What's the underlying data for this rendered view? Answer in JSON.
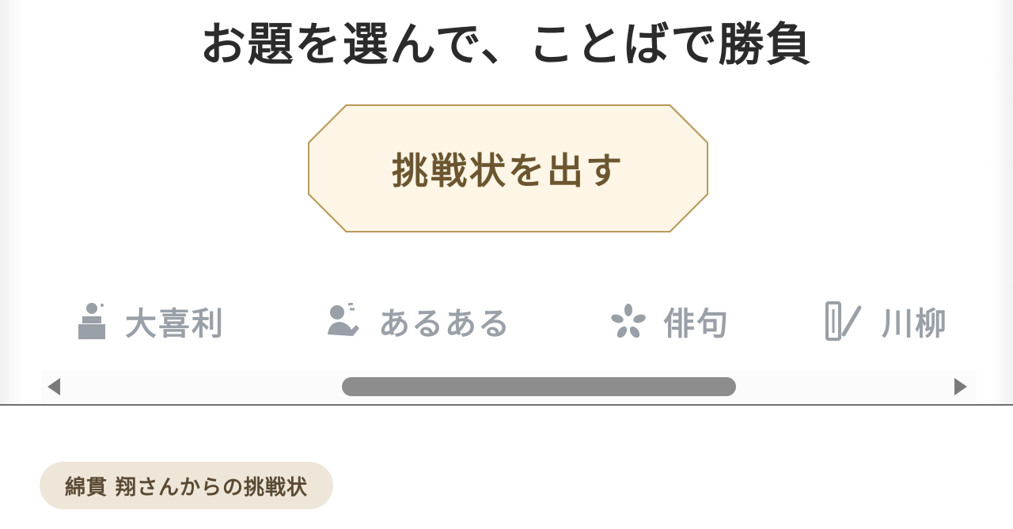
{
  "headline": "お題を選んで、ことばで勝負",
  "challenge_button": {
    "label": "挑戦状を出す"
  },
  "tabs": [
    {
      "label": "大喜利",
      "icon": "person-at-podium-icon"
    },
    {
      "label": "あるある",
      "icon": "person-thinking-icon"
    },
    {
      "label": "俳句",
      "icon": "flower-icon"
    },
    {
      "label": "川柳",
      "icon": "tanzaku-brush-icon"
    }
  ],
  "challenge_tag": {
    "label": "綿貫 翔さんからの挑戦状"
  },
  "colors": {
    "accent_gold": "#b89a58",
    "button_fill": "#fdf5e6",
    "button_text": "#6b5630",
    "tab_inactive": "#9aa0a8",
    "tag_bg": "#eee6d9"
  }
}
